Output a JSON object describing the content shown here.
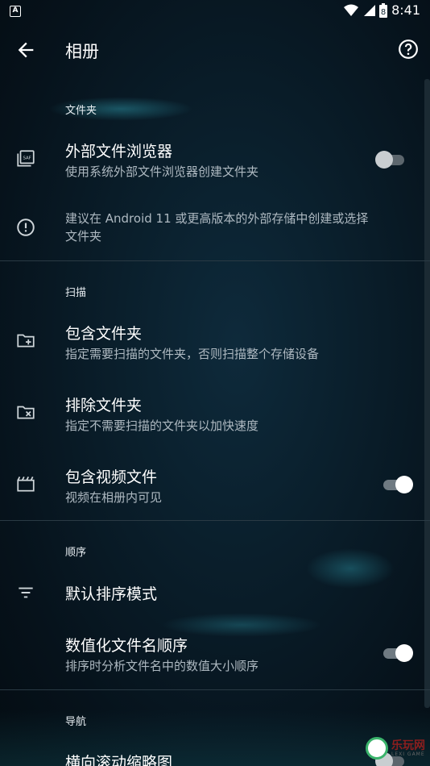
{
  "status_bar": {
    "time": "8:41",
    "battery": "8",
    "notification_icon": "a-icon"
  },
  "app_bar": {
    "title": "相册",
    "back_icon": "arrow-left-icon",
    "help_icon": "help-icon"
  },
  "sections": {
    "folders": {
      "header": "文件夹",
      "external_browser": {
        "title": "外部文件浏览器",
        "subtitle": "使用系统外部文件浏览器创建文件夹",
        "enabled": false
      },
      "info": {
        "line1": "建议在 Android 11 或更高版本的外部存储中创建或选择",
        "line2": "文件夹"
      }
    },
    "scan": {
      "header": "扫描",
      "include": {
        "title": "包含文件夹",
        "subtitle": "指定需要扫描的文件夹，否则扫描整个存储设备"
      },
      "exclude": {
        "title": "排除文件夹",
        "subtitle": "指定不需要扫描的文件夹以加快速度"
      },
      "videos": {
        "title": "包含视频文件",
        "subtitle": "视频在相册内可见",
        "enabled": true
      }
    },
    "order": {
      "header": "顺序",
      "default_sort": {
        "title": "默认排序模式"
      },
      "numeric": {
        "title": "数值化文件名顺序",
        "subtitle": "排序时分析文件名中的数值大小顺序",
        "enabled": true
      }
    },
    "navigation": {
      "header": "导航",
      "horizontal": {
        "title": "横向滚动缩略图",
        "enabled": false
      }
    }
  },
  "watermark": {
    "text": "乐玩网",
    "sub": "LEXI GAME"
  }
}
